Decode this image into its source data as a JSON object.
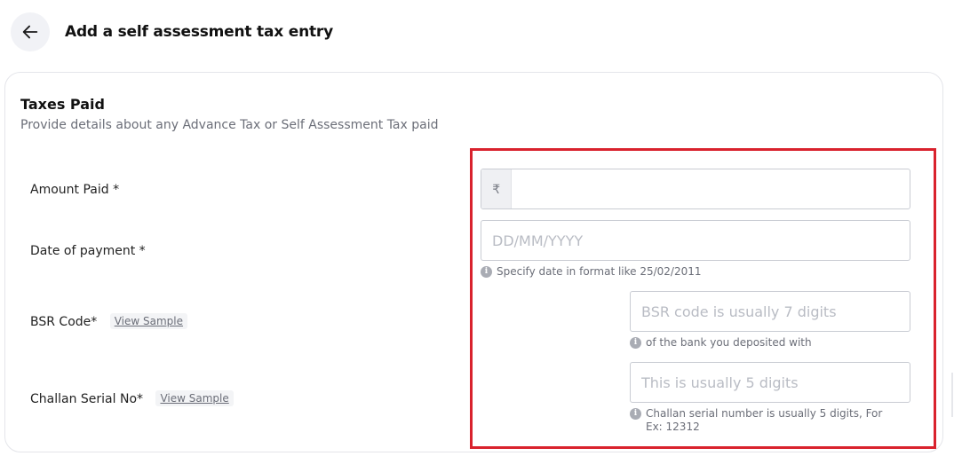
{
  "header": {
    "title": "Add a self assessment tax entry",
    "back_icon": "arrow-left-icon"
  },
  "section": {
    "title": "Taxes Paid",
    "subtitle": "Provide details about any Advance Tax or Self Assessment Tax paid"
  },
  "fields": {
    "amount": {
      "label": "Amount Paid *",
      "prefix": "₹",
      "value": ""
    },
    "date": {
      "label": "Date of payment *",
      "placeholder": "DD/MM/YYYY",
      "hint": "Specify date in format like 25/02/2011"
    },
    "bsr": {
      "label": "BSR Code*",
      "sample_link": "View Sample",
      "placeholder": "BSR code is usually 7 digits",
      "hint": "of the bank you deposited with"
    },
    "challan": {
      "label": "Challan Serial No*",
      "sample_link": "View Sample",
      "placeholder": "This is usually 5 digits",
      "hint": "Challan serial number is usually 5 digits, For Ex: 12312"
    }
  },
  "colors": {
    "highlight": "#d9222d",
    "card_border": "#e4e5ea",
    "muted_text": "#6b6e78"
  }
}
